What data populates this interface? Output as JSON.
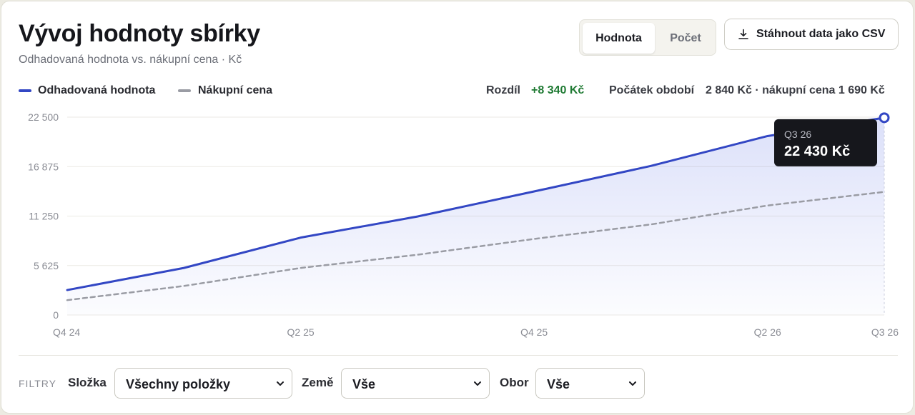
{
  "header": {
    "title": "Vývoj hodnoty sbírky",
    "subtitle": "Odhadovaná hodnota vs. nákupní cena · Kč"
  },
  "toggle": {
    "options": [
      "Hodnota",
      "Počet"
    ],
    "selected": "Hodnota"
  },
  "download": {
    "label": "Stáhnout data jako CSV",
    "icon": "download-icon"
  },
  "legend": [
    {
      "label": "Odhadovaná hodnota",
      "color": "#3347c4"
    },
    {
      "label": "Nákupní cena",
      "color": "#9a9ca4"
    }
  ],
  "stats": {
    "diff_label": "Rozdíl",
    "diff_value": "+8 340 Kč",
    "diff_color": "#1f7a33",
    "start_label": "Počátek období",
    "start_value": "2 840 Kč · nákupní cena 1 690 Kč"
  },
  "tooltip": {
    "period": "Q3 26",
    "value": "22 430 Kč"
  },
  "chart_data": {
    "type": "area",
    "categories": [
      "Q4 24",
      "Q1 25",
      "Q2 25",
      "Q3 25",
      "Q4 25",
      "Q1 26",
      "Q2 26",
      "Q3 26"
    ],
    "x_tick_labels": [
      "Q4 24",
      "Q2 25",
      "Q4 25",
      "Q2 26",
      "Q3 26"
    ],
    "y_tick_labels": [
      "22 500",
      "16 875",
      "11 250",
      "5 625",
      "0"
    ],
    "y_ticks": [
      0,
      5625,
      11250,
      16875,
      22500
    ],
    "ylim": [
      0,
      22500
    ],
    "grid": true,
    "series": [
      {
        "name": "Odhadovaná hodnota",
        "values": [
          2840,
          5350,
          8800,
          11200,
          14050,
          16950,
          20350,
          22430
        ],
        "color": "#3347c4",
        "style": "solid"
      },
      {
        "name": "Nákupní cena",
        "values": [
          1690,
          3300,
          5350,
          6850,
          8650,
          10300,
          12450,
          14000
        ],
        "color": "#9a9ca4",
        "style": "dashed"
      }
    ],
    "highlighted_index": 7
  },
  "filters": {
    "title": "FILTRY",
    "items": [
      {
        "label": "Složka",
        "value": "Všechny položky"
      },
      {
        "label": "Země",
        "value": "Vše"
      },
      {
        "label": "Obor",
        "value": "Vše"
      }
    ]
  }
}
